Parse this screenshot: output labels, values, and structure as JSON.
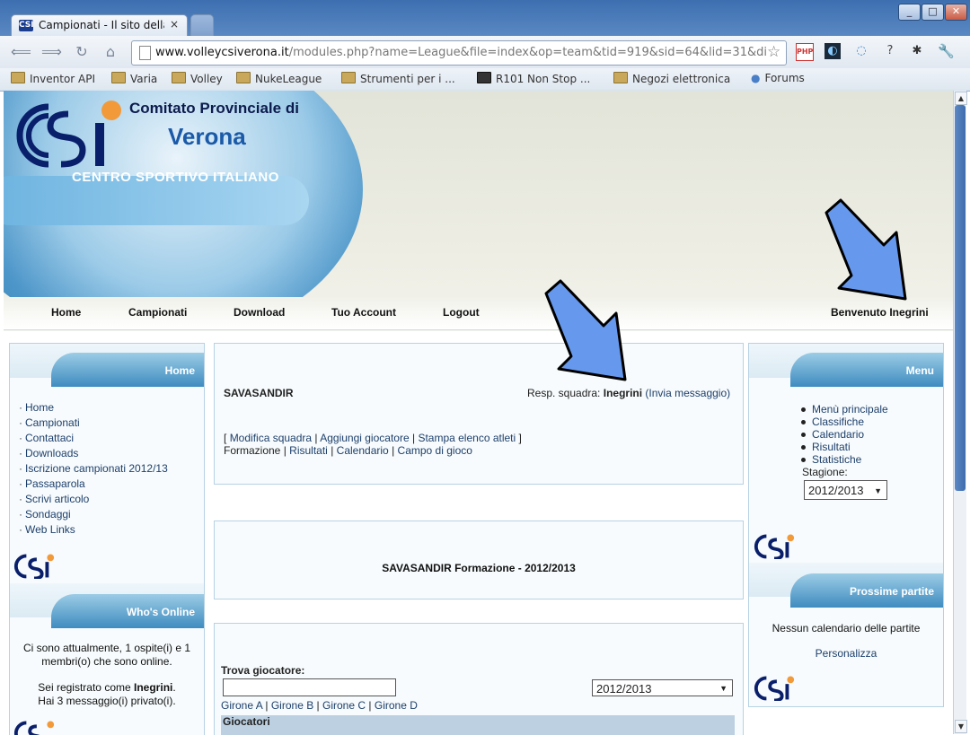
{
  "browser": {
    "tab_title": "Campionati - Il sito della",
    "tab_close": "×",
    "favicon": "CSI",
    "window_buttons": [
      "_",
      "□",
      "✕"
    ],
    "url_host": "www.volleycsiverona.it",
    "url_path": "/modules.php?name=League&file=index&op=team&tid=919&sid=64&lid=31&di",
    "bookmarks": [
      "Inventor API",
      "Varia",
      "Volley",
      "NukeLeague",
      "Strumenti per i ...",
      "R101 Non Stop ...",
      "Negozi elettronica",
      "Forums"
    ]
  },
  "header": {
    "line1": "Comitato Provinciale di",
    "line2": "Verona",
    "line3": "CENTRO SPORTIVO ITALIANO"
  },
  "nav": {
    "items": [
      "Home",
      "Campionati",
      "Download",
      "Tuo Account",
      "Logout"
    ],
    "welcome": "Benvenuto Inegrini"
  },
  "left": {
    "home_block": {
      "title": "Home",
      "items": [
        "Home",
        "Campionati",
        "Contattaci",
        "Downloads",
        "Iscrizione campionati 2012/13",
        "Passaparola",
        "Scrivi articolo",
        "Sondaggi",
        "Web Links"
      ]
    },
    "online_block": {
      "title": "Who's Online",
      "line1": "Ci sono attualmente, 1 ospite(i) e 1",
      "line2": "membri(o) che sono online.",
      "registered_prefix": "Sei registrato come",
      "registered_user": "Inegrini",
      "registered_suffix": ".",
      "messages": "Hai 3 messaggio(i) privato(i)."
    }
  },
  "center": {
    "team_name": "SAVASANDIR",
    "resp_label": "Resp. squadra:",
    "resp_name": "Inegrini",
    "resp_link": "(Invia messaggio)",
    "open_bracket": "[",
    "close_bracket": "]",
    "sep": "|",
    "actions": [
      "Modifica squadra",
      "Aggiungi giocatore",
      "Stampa elenco atleti"
    ],
    "tab_current": "Formazione",
    "tabs": [
      "Risultati",
      "Calendario",
      "Campo di gioco"
    ],
    "formation_title": "SAVASANDIR Formazione - 2012/2013",
    "find_label": "Trova giocatore:",
    "season_select": "2012/2013",
    "groups": [
      "Girone A",
      "Girone B",
      "Girone C",
      "Girone D"
    ],
    "players_header": "Giocatori"
  },
  "right": {
    "menu_block": {
      "title": "Menu",
      "items": [
        "Menù principale",
        "Classifiche",
        "Calendario",
        "Risultati",
        "Statistiche"
      ],
      "season_label": "Stagione:",
      "season_value": "2012/2013"
    },
    "next_block": {
      "title": "Prossime partite",
      "empty": "Nessun calendario delle partite",
      "customize": "Personalizza"
    }
  },
  "colors": {
    "arrow": "#6699ee",
    "panel_border": "#b8d2e4",
    "block_head": "#3f8cc0",
    "link": "#1d3f6b"
  }
}
